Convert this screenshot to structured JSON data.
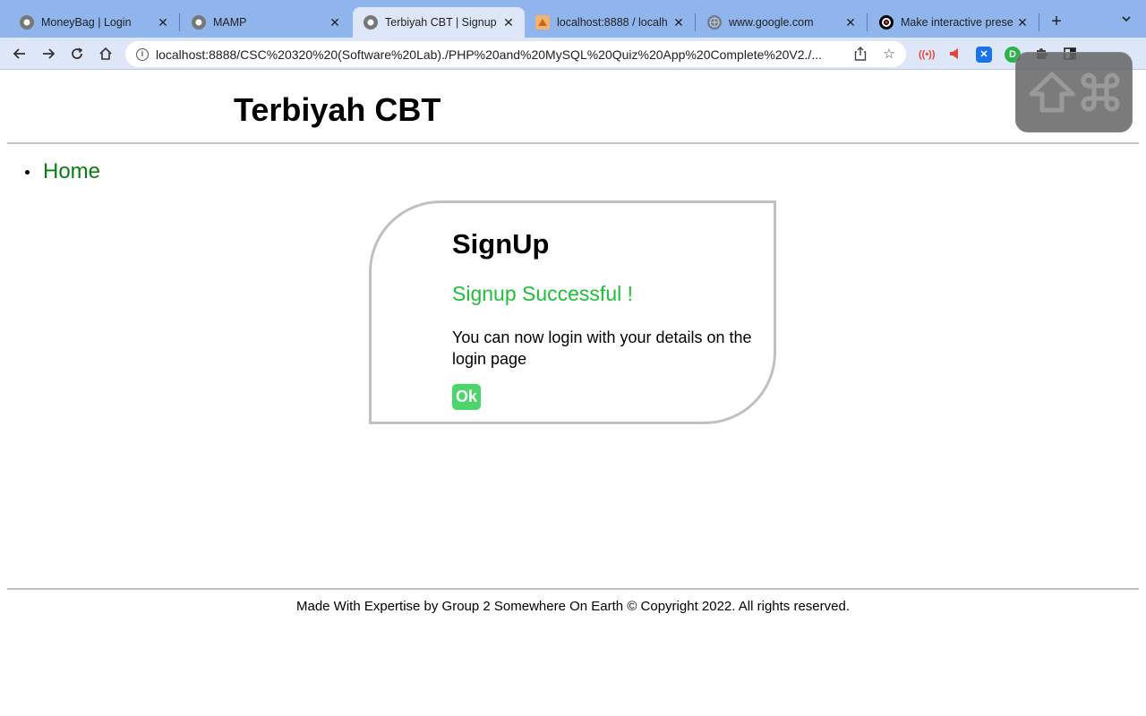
{
  "browser": {
    "tabs": [
      {
        "title": "MoneyBag | Login"
      },
      {
        "title": "MAMP"
      },
      {
        "title": "Terbiyah CBT | Signup"
      },
      {
        "title": "localhost:8888 / localh"
      },
      {
        "title": "www.google.com"
      },
      {
        "title": "Make interactive prese"
      }
    ],
    "active_tab": 2,
    "url": "localhost:8888/CSC%20320%20(Software%20Lab)./PHP%20and%20MySQL%20Quiz%20App%20Complete%20V2./..."
  },
  "page": {
    "site_title": "Terbiyah CBT",
    "nav": [
      {
        "label": "Home"
      }
    ],
    "card": {
      "heading": "SignUp",
      "success": "Signup Successful !",
      "message": "You can now login with your details on the login page",
      "ok_label": "Ok"
    },
    "footer": "Made With Expertise by Group 2 Somewhere On Earth © Copyright 2022. All rights reserved."
  },
  "colors": {
    "success_green": "#1fbf3a",
    "button_green": "#4cd56a",
    "link_green": "#0a7d12",
    "tabstrip": "#8fb5ec"
  }
}
